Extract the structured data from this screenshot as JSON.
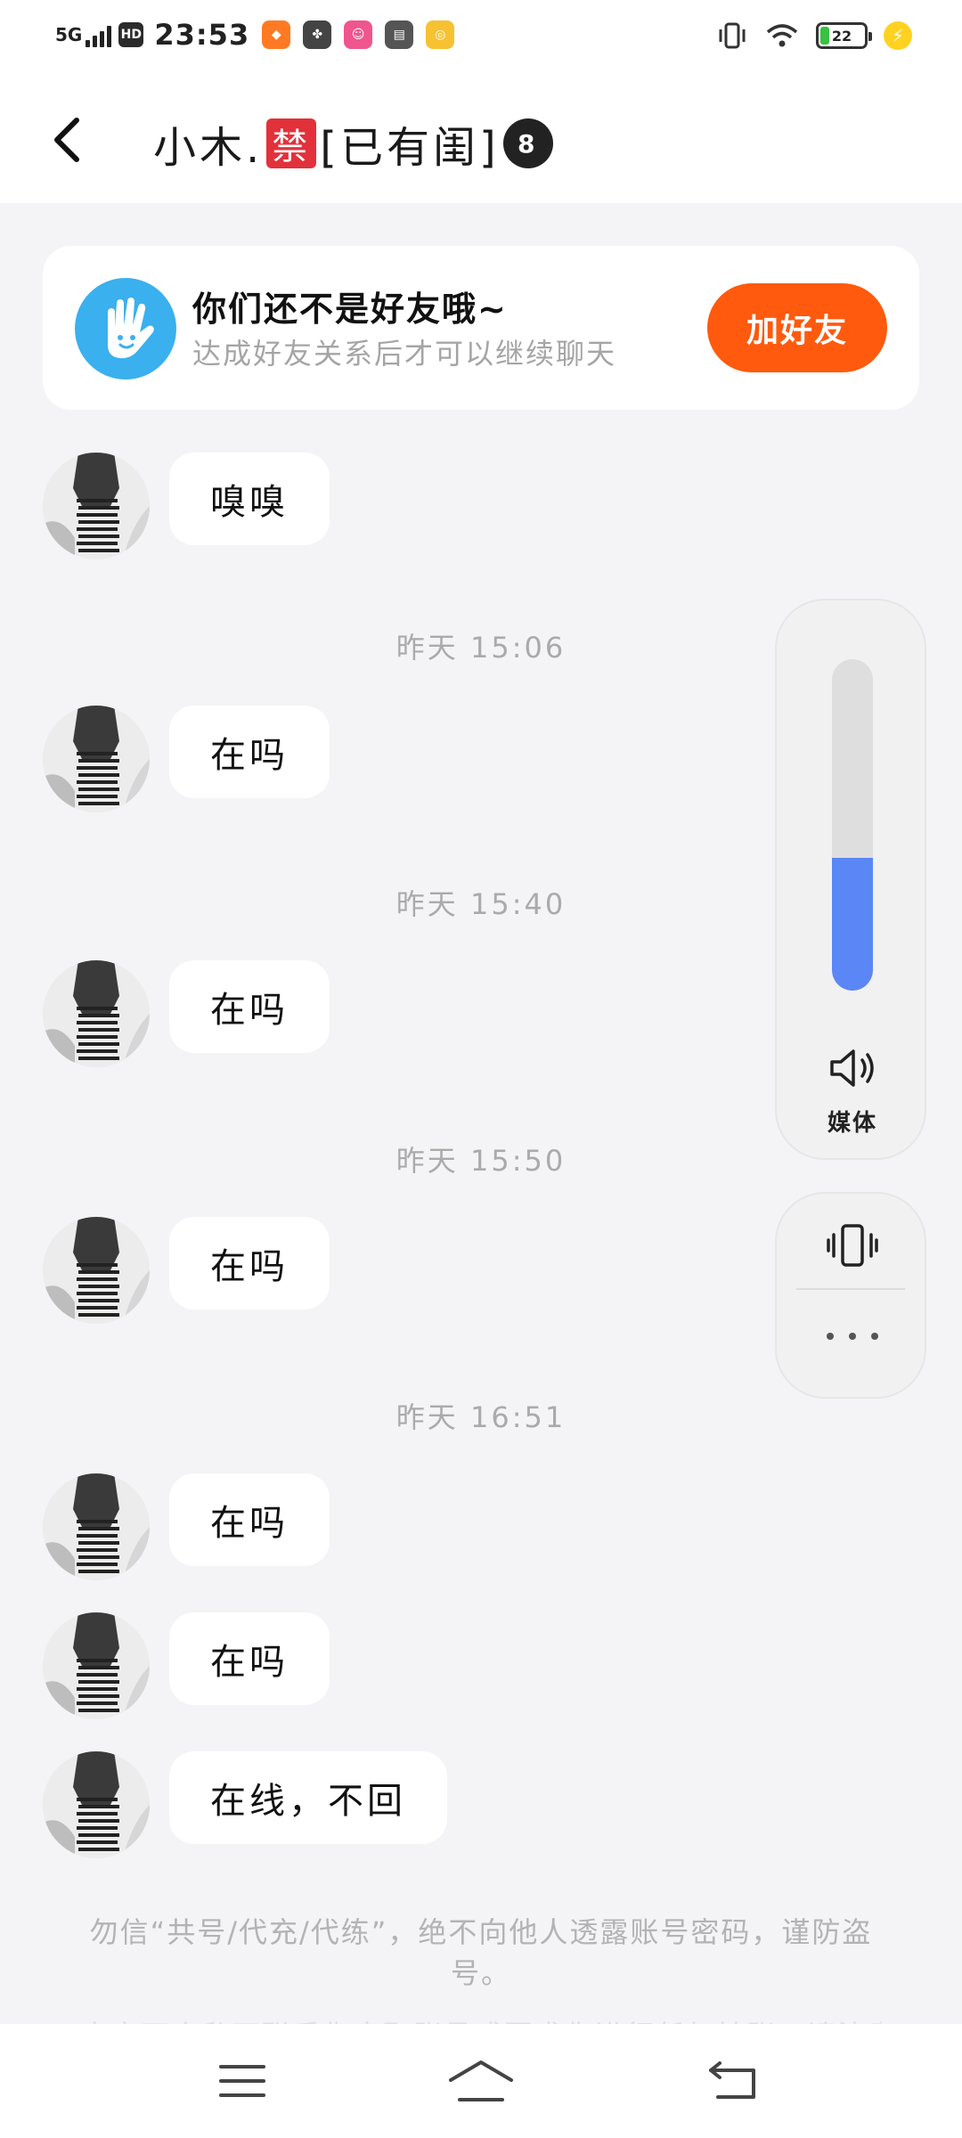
{
  "status_bar": {
    "network": "5G",
    "hd": "HD",
    "time": "23:53",
    "battery_level": "22",
    "icons": [
      "app-icon-1",
      "app-icon-2",
      "app-icon-3",
      "app-icon-4",
      "app-icon-5"
    ],
    "right_icons": [
      "vibrate-icon",
      "wifi-icon",
      "battery-icon",
      "charging-icon"
    ]
  },
  "header": {
    "title_prefix": "小木.",
    "title_badge": "禁",
    "title_suffix": "[已有闺]",
    "title_ball": "8"
  },
  "friend_banner": {
    "title": "你们还不是好友哦~",
    "subtitle": "达成好友关系后才可以继续聊天",
    "add_button_label": "加好友"
  },
  "messages": [
    {
      "text": "嗅嗅"
    },
    {
      "timestamp": "昨天 15:06"
    },
    {
      "text": "在吗"
    },
    {
      "timestamp": "昨天 15:40"
    },
    {
      "text": "在吗"
    },
    {
      "timestamp": "昨天 15:50"
    },
    {
      "text": "在吗"
    },
    {
      "timestamp": "昨天 16:51"
    },
    {
      "text": "在吗"
    },
    {
      "text": "在吗"
    },
    {
      "text": "在线，不回"
    }
  ],
  "volume_panel": {
    "level": 0.4,
    "label": "媒体",
    "accent_color": "#5b86f6"
  },
  "notice": {
    "text": "勿信“共号/代充/代练”，绝不向他人透露账号密码，谨防盗号。",
    "faded_text": "官方不会私下联系你索取账号或要求你进行任何转账，请注意甄别。"
  },
  "colors": {
    "add_friend": "#ff5a0e",
    "hand_avatar": "#3ab0ee",
    "ban_badge": "#e2313a"
  }
}
